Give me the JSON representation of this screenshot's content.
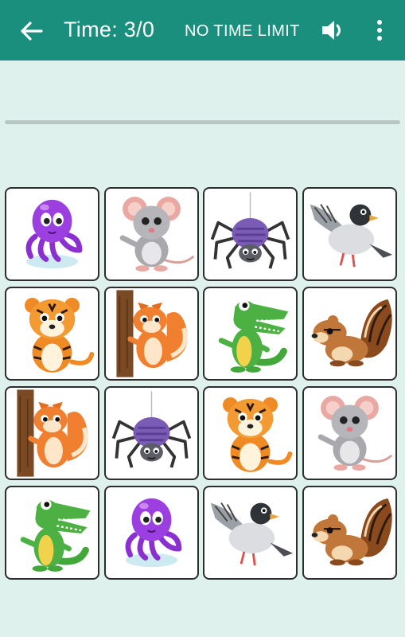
{
  "header": {
    "title": "Time: 3/0",
    "time_limit_label": "NO TIME LIMIT",
    "icons": [
      "back-arrow-icon",
      "volume-icon",
      "more-vert-icon"
    ]
  },
  "progress": {
    "fraction": 0
  },
  "colors": {
    "app_bar": "#1a8f7d",
    "background": "#dff1ec",
    "card_border": "#2d2d2d"
  },
  "board": {
    "rows": 4,
    "cols": 4,
    "cards": [
      "octopus",
      "mouse",
      "spider",
      "pigeon",
      "tiger",
      "squirrel",
      "crocodile",
      "chipmunk",
      "squirrel",
      "spider",
      "tiger",
      "mouse",
      "crocodile",
      "octopus",
      "pigeon",
      "chipmunk"
    ]
  }
}
